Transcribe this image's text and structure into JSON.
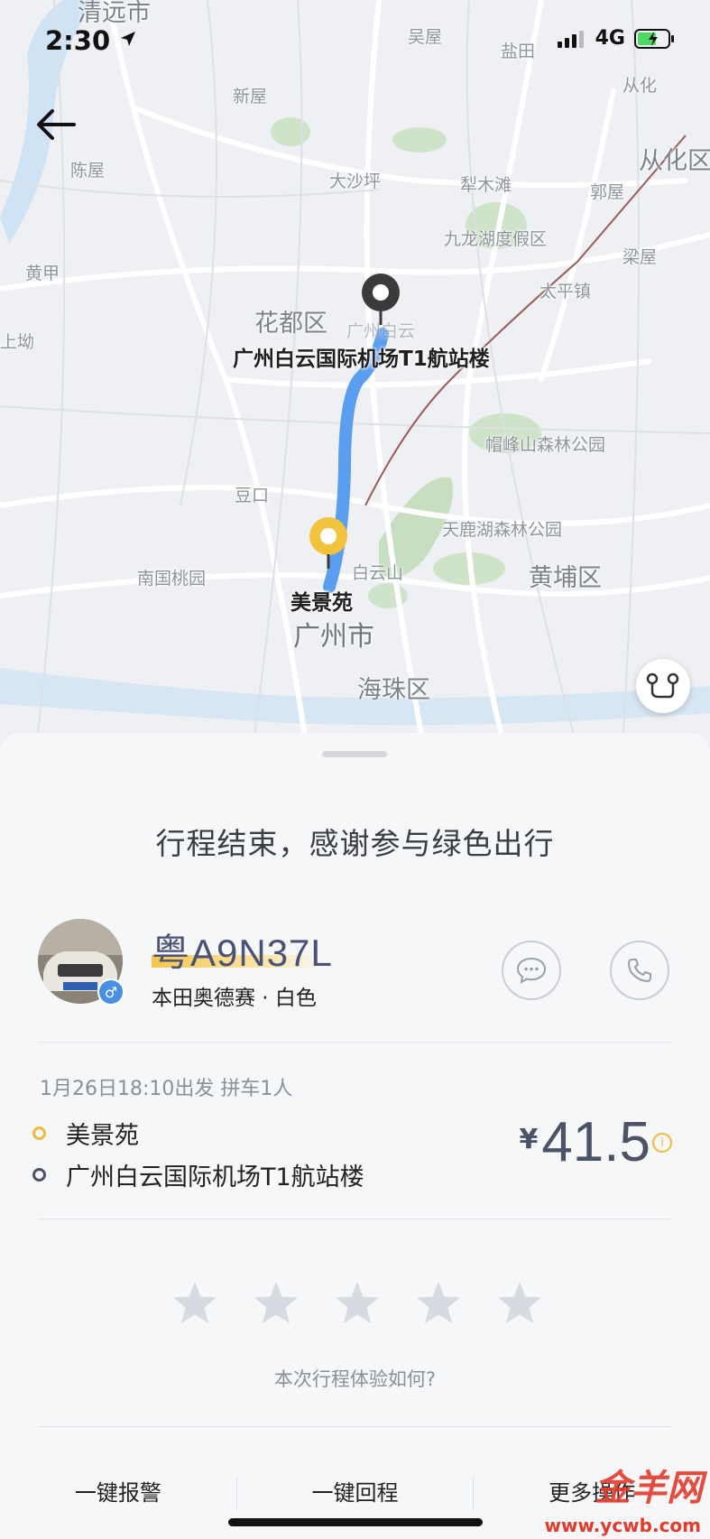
{
  "status_bar": {
    "time": "2:30",
    "network": "4G"
  },
  "map": {
    "places": {
      "qingyuan": "清远市",
      "wuwu": "吴屋",
      "yantian": "盐田",
      "conghua": "从化",
      "xinwu": "新屋",
      "conghua_district": "从化区",
      "chenwu": "陈屋",
      "dashaping": "大沙坪",
      "limuli": "犁木滩",
      "guowu": "郭屋",
      "jiulonghu": "九龙湖度假区",
      "huangjia": "黄甲",
      "liangwu": "梁屋",
      "taipingzhen": "太平镇",
      "huadu": "花都区",
      "shangao": "上坳",
      "baiyun_faint": "广州白云",
      "maofeng": "帽峰山森林公园",
      "doukou": "豆口",
      "tianlu": "天鹿湖森林公园",
      "nanguo": "南国桃园",
      "baiyunshan": "白云山",
      "huangpu": "黄埔区",
      "guangzhou": "广州市",
      "haizhu": "海珠区"
    },
    "destination_label": "广州白云国际机场T1航站楼",
    "origin_label": "美景苑",
    "route_color": "#5b9ef0"
  },
  "sheet": {
    "end_message": "行程结束，感谢参与绿色出行",
    "driver": {
      "plate": "粤A9N37L",
      "car_desc": "本田奥德赛 · 白色",
      "gender_symbol": "♂"
    },
    "trip": {
      "time_line": "1月26日18:10出发  拼车1人",
      "origin": "美景苑",
      "destination": "广州白云国际机场T1航站楼",
      "currency": "¥",
      "price": "41.5",
      "info_symbol": "i"
    },
    "rating": {
      "stars": 5,
      "selected": 0,
      "question": "本次行程体验如何?"
    },
    "footer": {
      "emergency": "一键报警",
      "return_trip": "一键回程",
      "more": "更多操作"
    },
    "watermark": {
      "logo": "金羊网",
      "url": "www.ycwb.com"
    }
  },
  "colors": {
    "accent": "#f0b93c",
    "plate_text": "#4a5275",
    "price": "#4b5366"
  }
}
